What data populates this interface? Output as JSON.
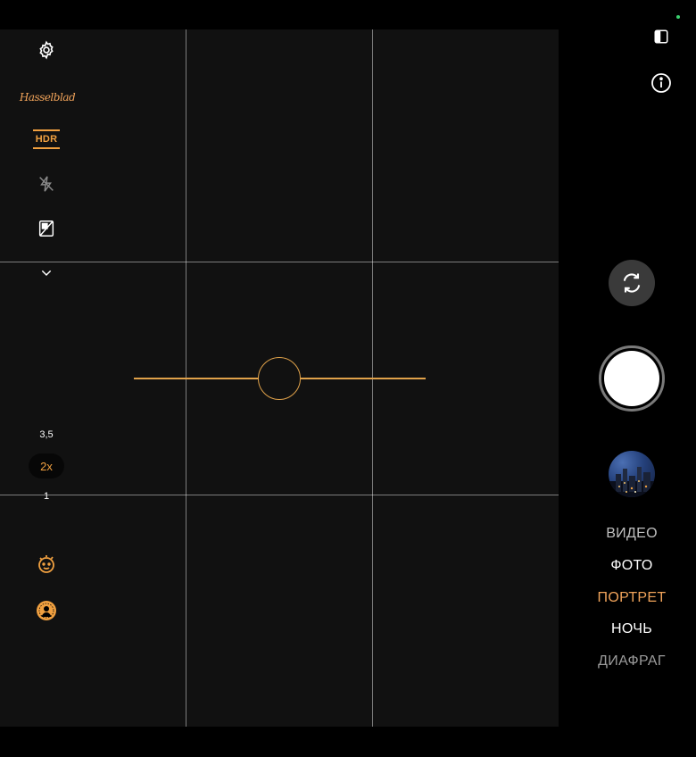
{
  "camera": {
    "left_toolbar": {
      "settings_icon": "gear-icon",
      "brand_filter_label": "Hasselblad",
      "hdr_label": "HDR",
      "flash_icon": "flash-off-icon",
      "aspect_icon": "aspect-ratio-icon",
      "expand_icon": "chevron-down-icon"
    },
    "zoom": {
      "levels": [
        "3,5",
        "2x",
        "1"
      ],
      "selected": "2x"
    },
    "bottom_left": {
      "beauty_icon": "face-retouch-icon",
      "portrait_light_icon": "portrait-lighting-icon"
    },
    "right_top": {
      "split_view_icon": "split-view-icon",
      "info_icon": "info-icon"
    },
    "controls": {
      "flip_camera_icon": "flip-camera-icon",
      "shutter": "shutter-button",
      "gallery": "gallery-thumbnail"
    },
    "modes": [
      "ВИДЕО",
      "ФОТО",
      "ПОРТРЕТ",
      "НОЧЬ",
      "ДИАФРАГ"
    ],
    "selected_mode": "ПОРТРЕТ",
    "colors": {
      "accent": "#f0a35a",
      "level": "#e0a24a",
      "status_dot": "#3bd16f"
    }
  }
}
